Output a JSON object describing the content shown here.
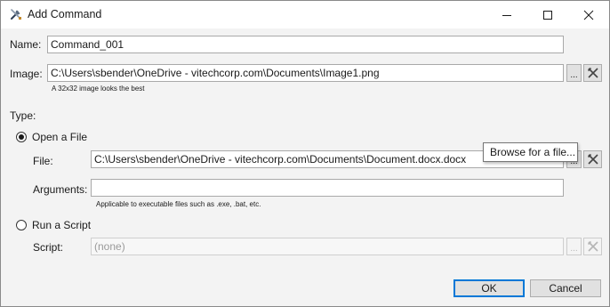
{
  "window": {
    "title": "Add Command",
    "icon": "tools-icon",
    "controls": {
      "minimize": "minimize-icon",
      "maximize": "maximize-icon",
      "close": "close-icon"
    }
  },
  "name": {
    "label": "Name:",
    "value": "Command_001"
  },
  "image": {
    "label": "Image:",
    "value": "C:\\Users\\sbender\\OneDrive - vitechcorp.com\\Documents\\Image1.png",
    "hint": "A 32x32 image looks the best",
    "browse_label": "...",
    "clear_icon": "clear-icon"
  },
  "type": {
    "label": "Type:",
    "open_file": {
      "label": "Open a File",
      "selected": true,
      "file_label": "File:",
      "file_value": "C:\\Users\\sbender\\OneDrive - vitechcorp.com\\Documents\\Document.docx.docx",
      "browse_label": "...",
      "arguments_label": "Arguments:",
      "arguments_value": "",
      "arguments_hint": "Applicable to executable files such as .exe, .bat, etc."
    },
    "run_script": {
      "label": "Run a Script",
      "selected": false,
      "script_label": "Script:",
      "script_value": "(none)",
      "browse_label": "..."
    }
  },
  "tooltip": {
    "text": "Browse for a file..."
  },
  "buttons": {
    "ok": "OK",
    "cancel": "Cancel"
  }
}
